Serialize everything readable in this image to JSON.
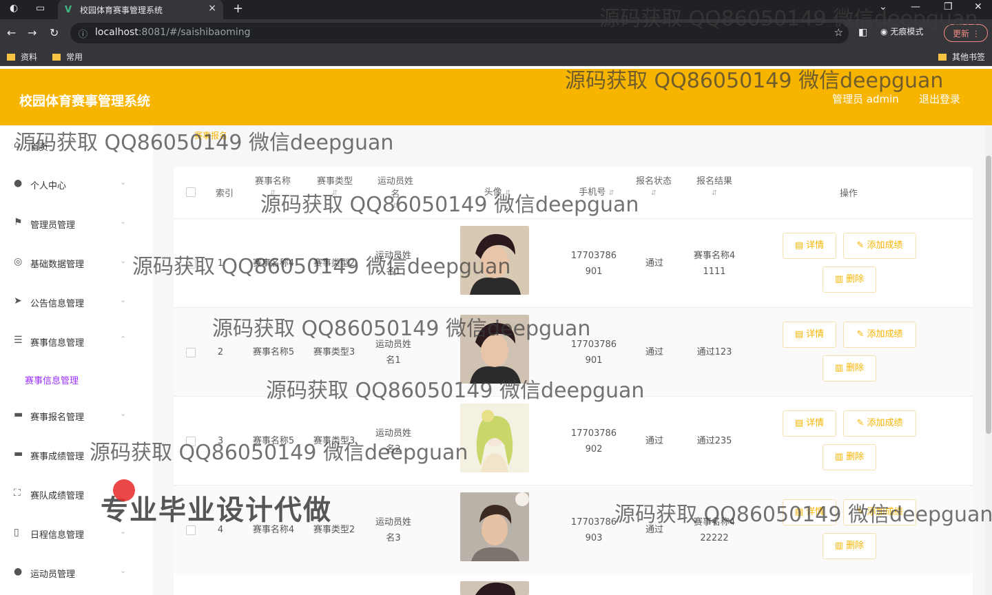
{
  "browser": {
    "tab_title": "校园体育赛事管理系统",
    "url_host": "localhost",
    "url_rest": ":8081/#/saishibaoming",
    "incognito_label": "无痕模式",
    "update_label": "更新",
    "bookmarks": [
      "资料",
      "常用"
    ],
    "other_bookmarks": "其他书签"
  },
  "header": {
    "title": "校园体育赛事管理系统",
    "user": "管理员 admin",
    "logout": "退出登录"
  },
  "sidebar": {
    "items": [
      {
        "label": "首页",
        "icon": "home-icon"
      },
      {
        "label": "个人中心",
        "icon": "user-icon"
      },
      {
        "label": "管理员管理",
        "icon": "flag-icon"
      },
      {
        "label": "基础数据管理",
        "icon": "target-icon"
      },
      {
        "label": "公告信息管理",
        "icon": "send-icon"
      },
      {
        "label": "赛事信息管理",
        "icon": "sliders-icon"
      },
      {
        "label": "赛事报名管理",
        "icon": "monitor-icon"
      },
      {
        "label": "赛事成绩管理",
        "icon": "monitor-icon"
      },
      {
        "label": "赛队成绩管理",
        "icon": "frame-icon"
      },
      {
        "label": "日程信息管理",
        "icon": "phone-icon"
      },
      {
        "label": "运动员管理",
        "icon": "pin-icon"
      }
    ],
    "active_submenu": "赛事信息管理"
  },
  "breadcrumb": "赛事报名",
  "table": {
    "headers": {
      "index": "索引",
      "event_name": "赛事名称",
      "event_type": "赛事类型",
      "athlete": "运动员姓名",
      "avatar": "头像",
      "phone": "手机号",
      "status": "报名状态",
      "result": "报名结果",
      "actions": "操作"
    },
    "rows": [
      {
        "index": "1",
        "event_name": "赛事名称4",
        "event_type": "赛事类型2",
        "athlete": [
          "运动员姓",
          "名1"
        ],
        "phone": [
          "17703786",
          "901"
        ],
        "status": "通过",
        "result": [
          "赛事名称4",
          "1111"
        ]
      },
      {
        "index": "2",
        "event_name": "赛事名称5",
        "event_type": "赛事类型3",
        "athlete": [
          "运动员姓",
          "名1"
        ],
        "phone": [
          "17703786",
          "901"
        ],
        "status": "通过",
        "result": [
          "通过123",
          ""
        ]
      },
      {
        "index": "3",
        "event_name": "赛事名称5",
        "event_type": "赛事类型3",
        "athlete": [
          "运动员姓",
          "名2"
        ],
        "phone": [
          "17703786",
          "902"
        ],
        "status": "通过",
        "result": [
          "通过235",
          ""
        ]
      },
      {
        "index": "4",
        "event_name": "赛事名称4",
        "event_type": "赛事类型2",
        "athlete": [
          "运动员姓",
          "名3"
        ],
        "phone": [
          "17703786",
          "903"
        ],
        "status": "通过",
        "result": [
          "赛事名称4",
          "22222"
        ]
      }
    ],
    "buttons": {
      "detail": "详情",
      "add_score": "添加成绩",
      "delete": "删除"
    }
  },
  "watermarks": {
    "text": "源码获取 QQ86050149 微信deepguan",
    "big": "专业毕业设计代做"
  },
  "colors": {
    "brand": "#f7b500",
    "submenu_active": "#9b30ff"
  }
}
